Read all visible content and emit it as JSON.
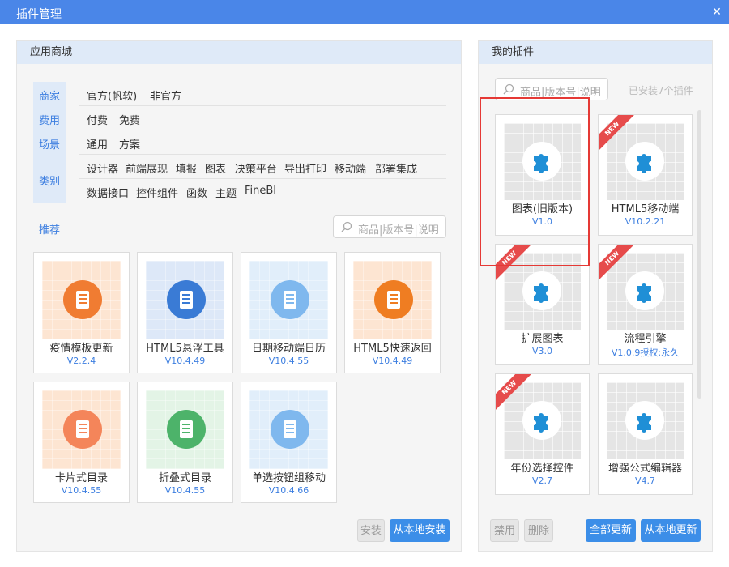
{
  "window": {
    "title": "插件管理",
    "close_glyph": "✕"
  },
  "left": {
    "header": "应用商城",
    "filter_tabs": [
      "商家",
      "费用",
      "场景",
      "类别"
    ],
    "filters": {
      "merchant": [
        "官方(帆软)",
        "非官方"
      ],
      "cost": [
        "付费",
        "免费"
      ],
      "scene": [
        "通用",
        "方案"
      ],
      "category_row1": [
        "设计器",
        "前端展现",
        "填报",
        "图表",
        "决策平台",
        "导出打印",
        "移动端",
        "部署集成"
      ],
      "category_row2": [
        "数据接口",
        "控件组件",
        "函数",
        "主题",
        "FineBI"
      ]
    },
    "recommend_label": "推荐",
    "search_placeholder": "商品|版本号|说明",
    "cards": [
      {
        "name": "疫情模板更新",
        "version": "V2.2.4",
        "bg": "#fde5d2",
        "icon_color": "#f07c32",
        "icon": "shield-icon"
      },
      {
        "name": "HTML5悬浮工具",
        "version": "V10.4.49",
        "bg": "#dde8f8",
        "icon_color": "#3a7bd5",
        "icon": "document-icon"
      },
      {
        "name": "日期移动端日历",
        "version": "V10.4.55",
        "bg": "#e1eefa",
        "icon_color": "#7fb8ee",
        "icon": "phone-icon"
      },
      {
        "name": "HTML5快速返回",
        "version": "V10.4.49",
        "bg": "#fde5d2",
        "icon_color": "#ef7d22",
        "icon": "grid-icon"
      },
      {
        "name": "卡片式目录",
        "version": "V10.4.55",
        "bg": "#fde5d2",
        "icon_color": "#f4855a",
        "icon": "cards-icon"
      },
      {
        "name": "折叠式目录",
        "version": "V10.4.55",
        "bg": "#e3f4e6",
        "icon_color": "#4db36a",
        "icon": "list-icon"
      },
      {
        "name": "单选按钮组移动",
        "version": "V10.4.66",
        "bg": "#e1eefa",
        "icon_color": "#7fb8ee",
        "icon": "phone-icon"
      }
    ],
    "buttons": {
      "install": "安装",
      "install_local": "从本地安装"
    }
  },
  "right": {
    "header": "我的插件",
    "search_placeholder": "商品|版本号|说明",
    "installed_text": "已安装7个插件",
    "ribbon_text": "NEW",
    "cards": [
      {
        "name": "图表(旧版本)",
        "version": "V1.0",
        "is_new": false
      },
      {
        "name": "HTML5移动端",
        "version": "V10.2.21",
        "is_new": true
      },
      {
        "name": "扩展图表",
        "version": "V3.0",
        "is_new": true
      },
      {
        "name": "流程引擎",
        "version": "V1.0.9授权:永久",
        "is_new": true
      },
      {
        "name": "年份选择控件",
        "version": "V2.7",
        "is_new": true
      },
      {
        "name": "增强公式编辑器",
        "version": "V4.7",
        "is_new": false
      }
    ],
    "buttons": {
      "disable": "禁用",
      "delete": "删除",
      "update_all": "全部更新",
      "update_local": "从本地更新"
    }
  },
  "colors": {
    "accent": "#3c8ee8",
    "titlebar": "#4a86e8",
    "plugin_icon": "#1f8fd6",
    "new_ribbon": "#e64b4b",
    "highlight": "#e53935"
  }
}
